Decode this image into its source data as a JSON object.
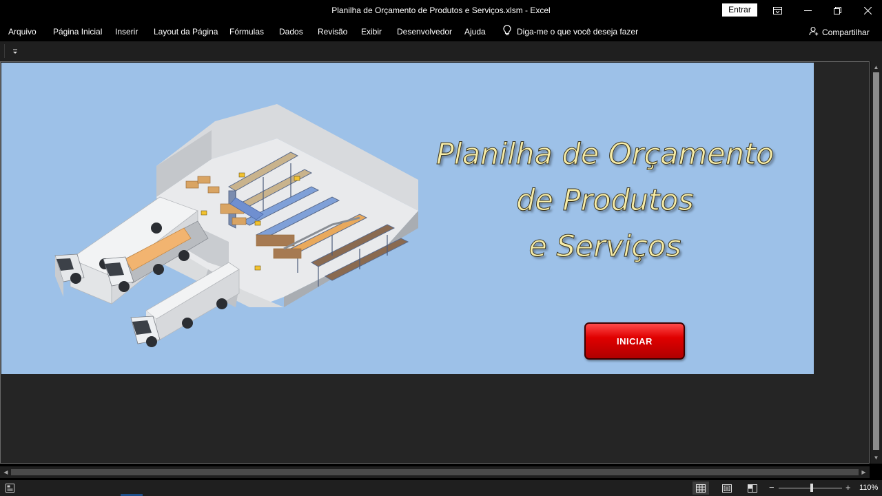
{
  "window": {
    "title": "Planilha de Orçamento de Produtos e Serviços.xlsm  -  Excel",
    "signin_label": "Entrar"
  },
  "menu": {
    "items": [
      "Arquivo",
      "Página Inicial",
      "Inserir",
      "Layout da Página",
      "Fórmulas",
      "Dados",
      "Revisão",
      "Exibir",
      "Desenvolvedor",
      "Ajuda"
    ],
    "tell_me": "Diga-me o que você deseja fazer",
    "share": "Compartilhar"
  },
  "sheet": {
    "headline_line1": "Planilha de Orçamento",
    "headline_line2": "de Produtos",
    "headline_line3": "e Serviços",
    "start_button": "INICIAR",
    "illustration": "warehouse-trucks-illustration"
  },
  "statusbar": {
    "zoom": "110%",
    "zoom_fraction": 0.52
  },
  "colors": {
    "sheet_bg": "#9dc1e8",
    "headline": "#f7eda8",
    "button": "#e00000"
  }
}
